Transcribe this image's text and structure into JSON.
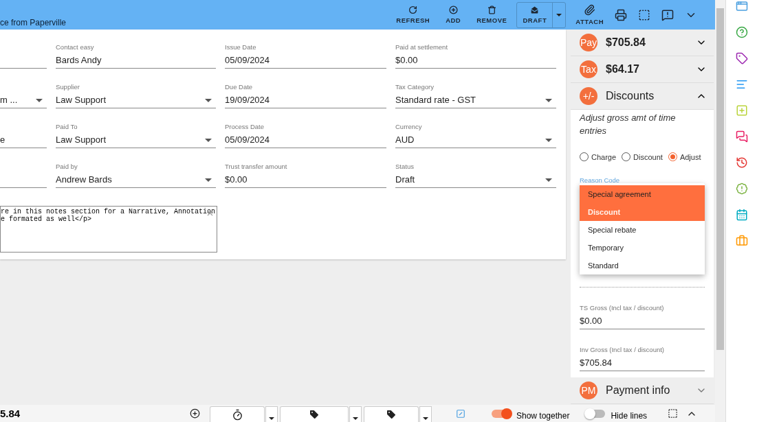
{
  "header": {
    "title": "ce from Paperville",
    "actions": [
      {
        "label": "REFRESH"
      },
      {
        "label": "ADD"
      },
      {
        "label": "REMOVE"
      }
    ],
    "draft": {
      "label": "DRAFT"
    },
    "attach": {
      "label": "ATTACH"
    }
  },
  "form": {
    "rows": [
      [
        {
          "kind": "text"
        },
        {
          "label": "Contact easy",
          "value": "Bards Andy",
          "kind": "text"
        },
        {
          "label": "Issue Date",
          "value": "05/09/2024",
          "kind": "text"
        },
        {
          "label": "Paid at settlement",
          "value": "$0.00",
          "kind": "text"
        }
      ],
      [
        {
          "value": "m ...",
          "kind": "select"
        },
        {
          "label": "Supplier",
          "value": "Law Support",
          "kind": "select"
        },
        {
          "label": "Due Date",
          "value": "19/09/2024",
          "kind": "text"
        },
        {
          "label": "Tax Category",
          "value": "Standard rate - GST",
          "kind": "select"
        }
      ],
      [
        {
          "value": "e",
          "kind": "text"
        },
        {
          "label": "Paid To",
          "value": "Law Support",
          "kind": "select"
        },
        {
          "label": "Process Date",
          "value": "05/09/2024",
          "kind": "text"
        },
        {
          "label": "Currency",
          "value": "AUD",
          "kind": "select"
        }
      ],
      [
        {
          "kind": "text"
        },
        {
          "label": "Paid by",
          "value": "Andrew Bards",
          "kind": "select"
        },
        {
          "label": "Trust transfer amount",
          "value": "$0.00",
          "kind": "text"
        },
        {
          "label": "Status",
          "value": "Draft",
          "kind": "select"
        }
      ]
    ],
    "notes": "re in this notes section for a Narrative, Annotation\ne formated as well</p>"
  },
  "summary": [
    {
      "badge": "Pay",
      "title": "$705.84",
      "expanded": false
    },
    {
      "badge": "Tax",
      "title": "$64.17",
      "expanded": false
    },
    {
      "badge": "+/-",
      "title": "Discounts",
      "expanded": true
    }
  ],
  "discounts": {
    "description": "Adjust gross amt of time entries",
    "modes": [
      {
        "label": "Charge",
        "selected": false
      },
      {
        "label": "Discount",
        "selected": false
      },
      {
        "label": "Adjust",
        "selected": true
      }
    ],
    "reason_label": "Reason Code",
    "reason_options": [
      {
        "label": "Special agreement",
        "highlighted": true,
        "selected": false
      },
      {
        "label": "Discount",
        "highlighted": true,
        "selected": true
      },
      {
        "label": "Special rebate",
        "highlighted": false,
        "selected": false
      },
      {
        "label": "Temporary",
        "highlighted": false,
        "selected": false
      },
      {
        "label": "Standard",
        "highlighted": false,
        "selected": false
      }
    ],
    "fields": [
      {
        "label": "TS Gross (Incl tax / discount)",
        "value": "$0.00"
      },
      {
        "label": "Inv Gross (Incl tax / discount)",
        "value": "$705.84"
      }
    ]
  },
  "payment": {
    "badge": "PM",
    "title": "Payment info",
    "expanded": false
  },
  "footer": {
    "total": "5.84",
    "show_together": {
      "label": "Show together",
      "on": true
    },
    "hide_lines": {
      "label": "Hide lines",
      "on": false
    }
  }
}
